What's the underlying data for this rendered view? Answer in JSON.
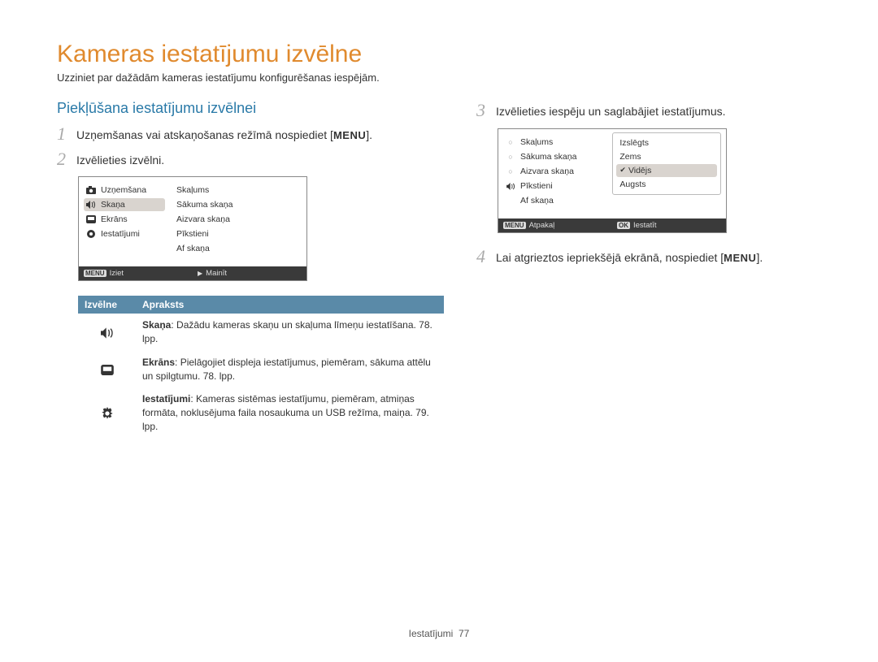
{
  "title": "Kameras iestatījumu izvēlne",
  "subtitle": "Uzziniet par dažādām kameras iestatījumu konfigurēšanas iespējām.",
  "section_heading": "Piekļūšana iestatījumu izvēlnei",
  "steps": {
    "s1_pre": "Uzņemšanas vai atskaņošanas režīmā nospiediet [",
    "s1_btn": "MENU",
    "s1_post": "].",
    "s2": "Izvēlieties izvēlni.",
    "s3": "Izvēlieties iespēju un saglabājiet iestatījumus.",
    "s4_pre": "Lai atgrieztos iepriekšējā ekrānā, nospiediet [",
    "s4_btn": "MENU",
    "s4_post": "]."
  },
  "lcd1": {
    "left": [
      "Uzņemšana",
      "Skaņa",
      "Ekrāns",
      "Iestatījumi"
    ],
    "selected_left": 1,
    "right": [
      "Skaļums",
      "Sākuma skaņa",
      "Aizvara skaņa",
      "Pīkstieni",
      "Af skaņa"
    ],
    "footer_left_key": "MENU",
    "footer_left": "Iziet",
    "footer_right_icon": "▶",
    "footer_right": "Mainīt"
  },
  "table": {
    "head_menu": "Izvēlne",
    "head_desc": "Apraksts",
    "rows": [
      {
        "icon": "sound",
        "bold": "Skaņa",
        "text": ": Dažādu kameras skaņu un skaļuma līmeņu iestatīšana. 78. lpp."
      },
      {
        "icon": "display",
        "bold": "Ekrāns",
        "text": ": Pielāgojiet displeja iestatījumus, piemēram, sākuma attēlu un spilgtumu. 78. lpp."
      },
      {
        "icon": "gear",
        "bold": "Iestatījumi",
        "text": ": Kameras sistēmas iestatījumu, piemēram, atmiņas formāta, noklusējuma faila nosaukuma un USB režīma, maiņa. 79. lpp."
      }
    ]
  },
  "lcd2": {
    "left": [
      "Skaļums",
      "Sākuma skaņa",
      "Aizvara skaņa",
      "Pīkstieni",
      "Af skaņa"
    ],
    "active_speaker_index": 3,
    "right": [
      "Izslēgts",
      "Zems",
      "Vidējs",
      "Augsts"
    ],
    "selected_right": 2,
    "footer_left_key": "MENU",
    "footer_left": "Atpakaļ",
    "footer_right_key": "OK",
    "footer_right": "Iestatīt"
  },
  "footer": {
    "section": "Iestatījumi",
    "page": "77"
  }
}
